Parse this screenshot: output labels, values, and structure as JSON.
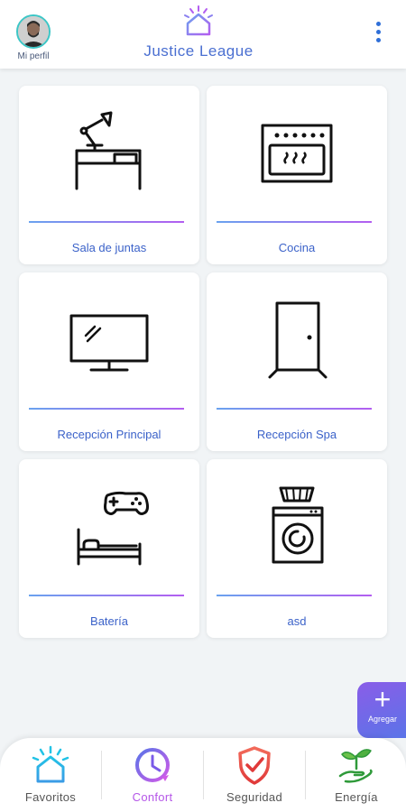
{
  "header": {
    "profile_label": "Mi perfil",
    "title": "Justice League",
    "menu_icon": "more-vertical-icon",
    "logo_icon": "smart-home-logo-icon"
  },
  "rooms": [
    {
      "label": "Sala de juntas",
      "icon": "desk-lamp-icon"
    },
    {
      "label": "Cocina",
      "icon": "oven-icon"
    },
    {
      "label": "Recepción Principal",
      "icon": "tv-icon"
    },
    {
      "label": "Recepción Spa",
      "icon": "door-icon"
    },
    {
      "label": "Batería",
      "icon": "bed-gamepad-icon"
    },
    {
      "label": "asd",
      "icon": "washing-machine-icon"
    }
  ],
  "fab": {
    "label": "Agregar",
    "icon": "plus-icon"
  },
  "tabs": [
    {
      "label": "Favoritos",
      "icon": "home-icon",
      "active": false
    },
    {
      "label": "Confort",
      "icon": "clock-icon",
      "active": true
    },
    {
      "label": "Seguridad",
      "icon": "shield-check-icon",
      "active": false
    },
    {
      "label": "Energía",
      "icon": "plant-hand-icon",
      "active": false
    }
  ],
  "colors": {
    "accent_blue": "#3b62c9",
    "accent_purple": "#b35ef0",
    "active_tab": "#b556e8",
    "background": "#f1f4f6"
  }
}
